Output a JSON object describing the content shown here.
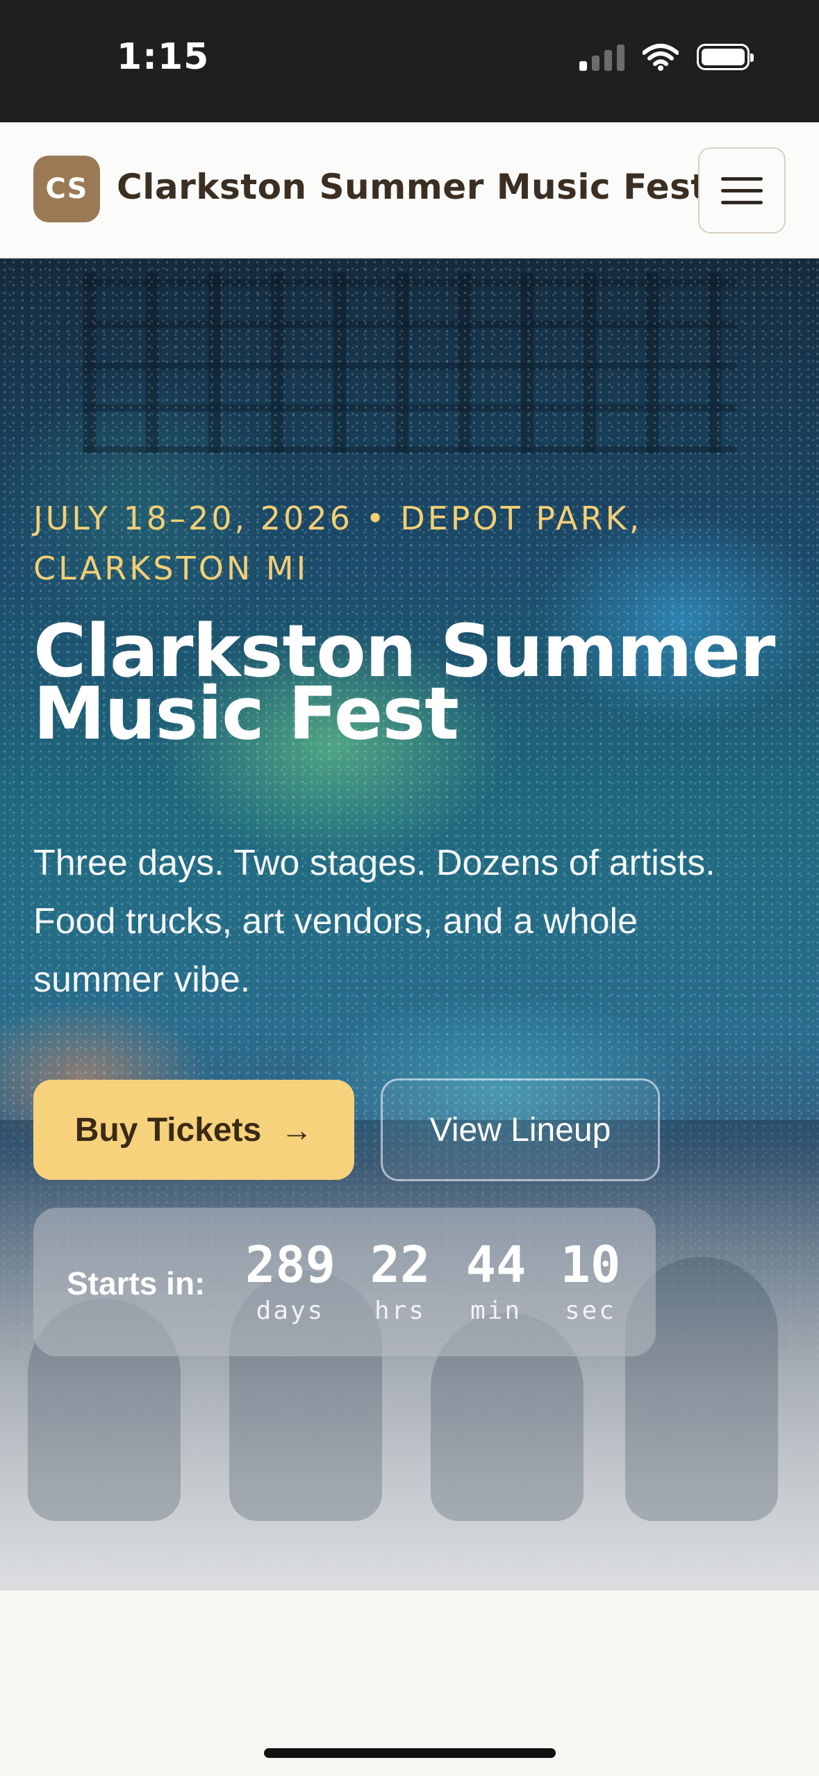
{
  "status_bar": {
    "time": "1:15"
  },
  "header": {
    "logo_initials": "CS",
    "title": "Clarkston Summer Music Fest",
    "menu_icon": "hamburger-icon"
  },
  "hero": {
    "eyebrow": "JULY 18–20, 2026 • DEPOT PARK, CLARKSTON MI",
    "title": "Clarkston Summer Music Fest",
    "subtitle": "Three days. Two stages. Dozens of artists. Food trucks, art vendors, and a whole summer vibe.",
    "buttons": {
      "tickets_label": "Buy Tickets",
      "tickets_icon": "arrow-right-icon",
      "lineup_label": "View Lineup"
    },
    "countdown": {
      "label": "Starts in:",
      "units": [
        {
          "value": "289",
          "caption": "days"
        },
        {
          "value": "22",
          "caption": "hrs"
        },
        {
          "value": "44",
          "caption": "min"
        },
        {
          "value": "10",
          "caption": "sec"
        }
      ]
    }
  },
  "colors": {
    "accent": "#f7d27c",
    "brand": "#9a7a55",
    "eyebrow": "#f3cf75",
    "header_bg": "#fbfbfa"
  }
}
